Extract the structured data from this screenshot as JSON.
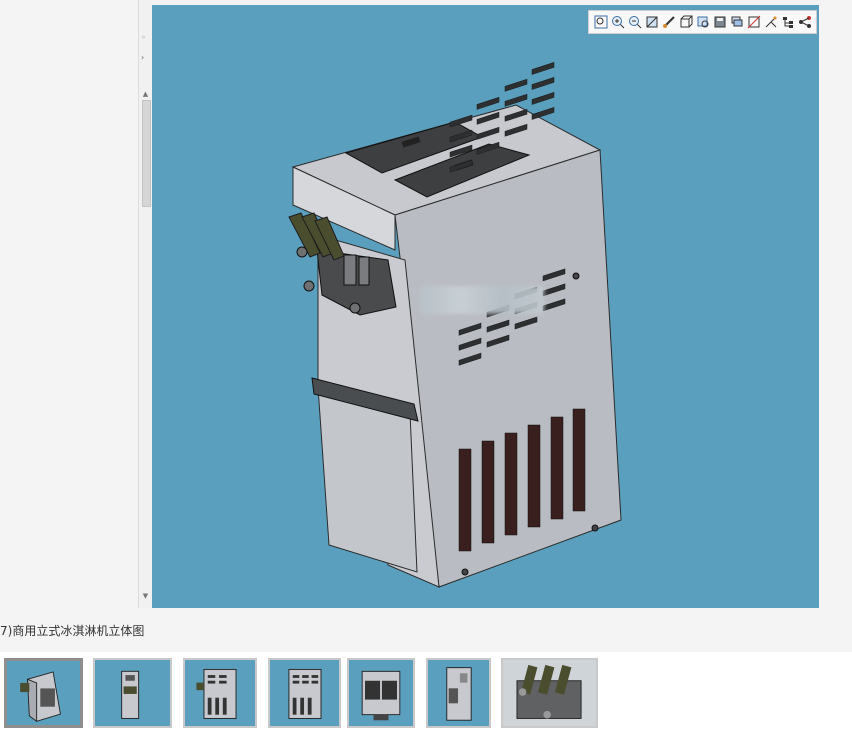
{
  "viewer": {
    "background_color": "#5aa0be",
    "model_name": "ice-cream-machine-3d-model",
    "toolbar_icons": [
      "zoom-fit-icon",
      "zoom-in-icon",
      "zoom-out-icon",
      "view-box-icon",
      "measure-icon",
      "view-cube-icon",
      "search-part-icon",
      "save-view-icon",
      "layers-icon",
      "section-icon",
      "explode-icon",
      "tree-icon",
      "share-icon"
    ]
  },
  "caption": "7)商用立式冰淇淋机立体图",
  "thumbnails": [
    {
      "name": "iso-view",
      "active": true
    },
    {
      "name": "front-view",
      "active": false
    },
    {
      "name": "left-view",
      "active": false
    },
    {
      "name": "side-view",
      "active": false
    },
    {
      "name": "top-view",
      "active": false
    },
    {
      "name": "right-view",
      "active": false
    },
    {
      "name": "dispenser-detail",
      "active": false
    }
  ]
}
